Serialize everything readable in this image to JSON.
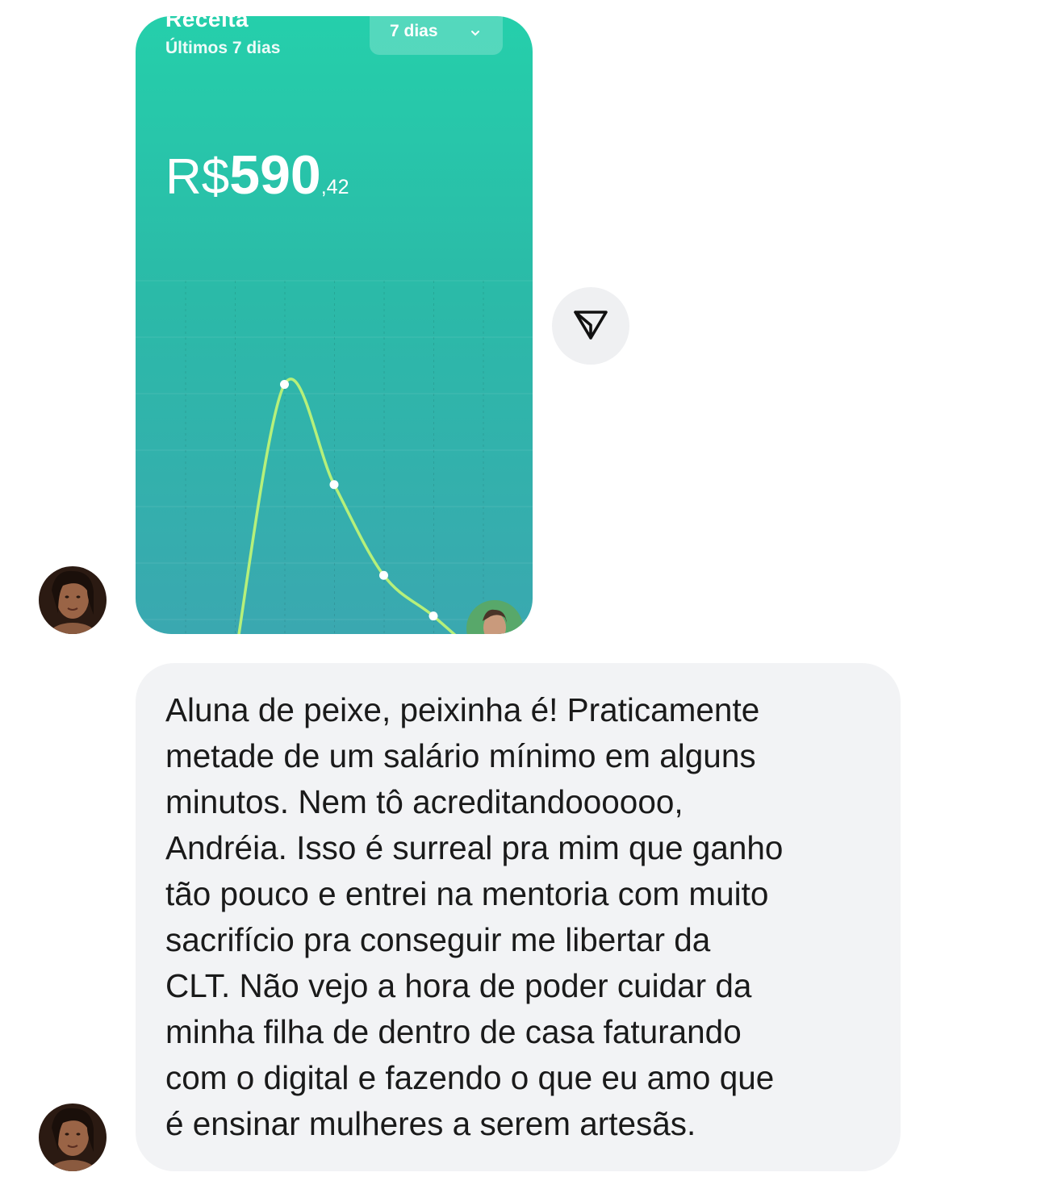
{
  "message_1": {
    "type": "image",
    "card": {
      "title": "Receita",
      "subtitle": "Últimos 7 dias",
      "range_select": {
        "value": "7 dias"
      },
      "amount": {
        "currency": "R$",
        "integer": "590",
        "cents": ",42"
      }
    }
  },
  "share_button": {
    "icon": "send-icon"
  },
  "message_2": {
    "type": "text",
    "text": "Aluna de peixe, peixinha é! Praticamente\nmetade de um salário mínimo em alguns\nminutos. Nem tô acreditandoooooo,\nAndréia. Isso é surreal pra mim que ganho\ntão pouco e entrei na mentoria com muito\nsacrifício pra conseguir me libertar da\nCLT. Não vejo a hora de poder cuidar da\nminha filha de dentro de casa faturando\ncom o digital e fazendo o que eu amo que\né ensinar mulheres a serem artesãs."
  },
  "colors": {
    "card_gradient_top": "#25cfab",
    "card_gradient_bottom": "#3aa8b0",
    "chart_line": "#b6f07a",
    "bubble_bg": "#f2f3f5",
    "send_button_bg": "#eff0f2"
  },
  "chart_data": {
    "type": "line",
    "series": [
      {
        "values": [
          0,
          88,
          56,
          27,
          14,
          0
        ]
      }
    ],
    "ylim": [
      0,
      100
    ],
    "grid": true
  }
}
